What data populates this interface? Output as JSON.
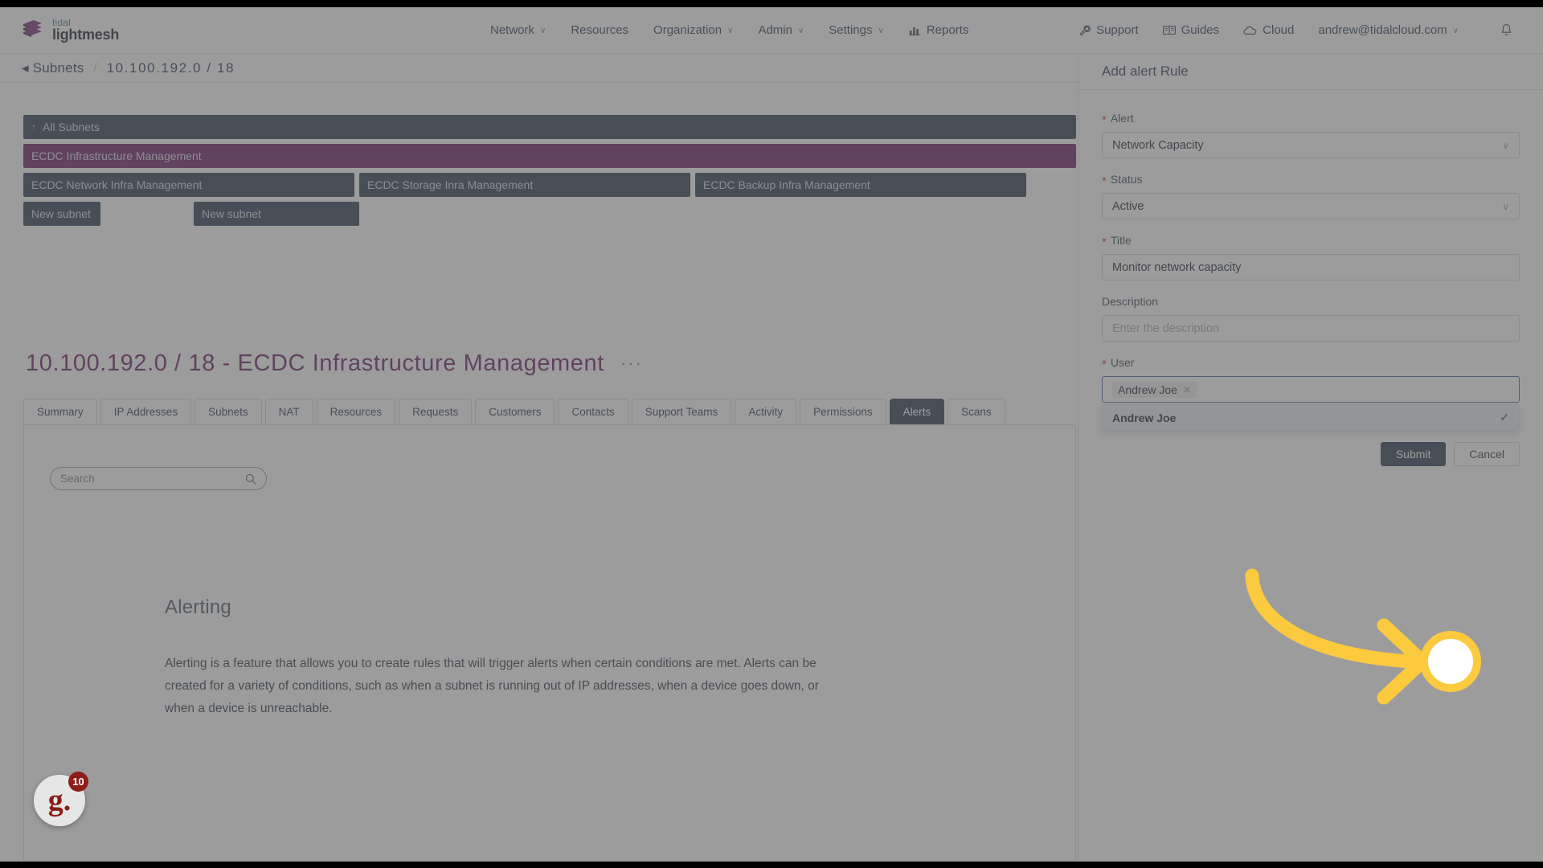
{
  "brand": {
    "top": "tidal",
    "bottom": "lightmesh",
    "mark": "stacked-layers-logo"
  },
  "topnav": {
    "items": [
      {
        "label": "Network",
        "caret": "∨",
        "icon": ""
      },
      {
        "label": "Resources",
        "caret": "",
        "icon": ""
      },
      {
        "label": "Organization",
        "caret": "∨",
        "icon": ""
      },
      {
        "label": "Admin",
        "caret": "∨",
        "icon": ""
      },
      {
        "label": "Settings",
        "caret": "∨",
        "icon": ""
      },
      {
        "label": "Reports",
        "caret": "",
        "icon": "bar-chart-icon"
      }
    ],
    "right": [
      {
        "label": "Support",
        "icon": "wrench-icon"
      },
      {
        "label": "Guides",
        "icon": "book-icon"
      },
      {
        "label": "Cloud",
        "icon": "cloud-icon"
      },
      {
        "label": "andrew@tidalcloud.com",
        "icon": "",
        "caret": "∨"
      }
    ],
    "bell": "bell-icon"
  },
  "breadcrumb": {
    "back_arrow": "◂",
    "back_label": "Subnets",
    "separator": "/",
    "current": "10.100.192.0 / 18"
  },
  "subnet_map": {
    "root": {
      "label": "All Subnets",
      "up_arrow": "↑"
    },
    "selected": {
      "label": "ECDC Infrastructure Management"
    },
    "children": [
      "ECDC Network Infra Management",
      "ECDC Storage Inra Management",
      "ECDC Backup Infra Management"
    ],
    "new_subnets": [
      "New subnet",
      "New subnet"
    ],
    "colors": {
      "bar": "#2c3e54",
      "selected": "#6b1f66"
    }
  },
  "page": {
    "title": "10.100.192.0 / 18 - ECDC Infrastructure Management",
    "title_color": "#6b1f66",
    "more_actions": "···"
  },
  "tabs": {
    "items": [
      "Summary",
      "IP Addresses",
      "Subnets",
      "NAT",
      "Resources",
      "Requests",
      "Customers",
      "Contacts",
      "Support Teams",
      "Activity",
      "Permissions",
      "Alerts",
      "Scans"
    ],
    "active": "Alerts"
  },
  "search": {
    "placeholder": "Search",
    "value": "",
    "icon": "search-icon"
  },
  "empty_state": {
    "title": "Alerting",
    "body": "Alerting is a feature that allows you to create rules that will trigger alerts when certain conditions are met. Alerts can be created for a variety of conditions, such as when a subnet is running out of IP addresses, when a device goes down, or when a device is unreachable."
  },
  "side_panel": {
    "title": "Add alert Rule",
    "fields": {
      "alert": {
        "label": "Alert",
        "required": "*",
        "value": "Network Capacity",
        "caret": "∨"
      },
      "status": {
        "label": "Status",
        "required": "*",
        "value": "Active",
        "caret": "∨"
      },
      "title": {
        "label": "Title",
        "required": "*",
        "value": "Monitor network capacity"
      },
      "description": {
        "label": "Description",
        "required": "",
        "value": "",
        "placeholder": "Enter the description"
      },
      "user": {
        "label": "User",
        "required": "*",
        "tag": "Andrew Joe",
        "tag_remove": "✕",
        "options": [
          {
            "label": "Andrew Joe",
            "selected_mark": "✓"
          }
        ]
      }
    },
    "buttons": {
      "submit": "Submit",
      "cancel": "Cancel"
    }
  },
  "annotation": {
    "type": "curved-arrow-highlight",
    "color": "#fbca3e"
  },
  "badge": {
    "logo": "g.",
    "count": "10",
    "color": "#8c1d18"
  }
}
